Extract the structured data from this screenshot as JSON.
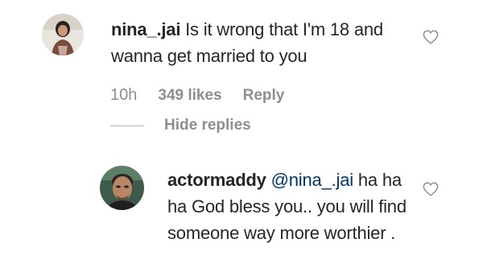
{
  "comments": [
    {
      "username": "nina_.jai",
      "text": " Is it wrong that I'm 18 and wanna get married to you",
      "time": "10h",
      "likes": "349 likes",
      "reply_label": "Reply",
      "hide_replies_label": "Hide replies",
      "avatar_icon": "profile-photo-woman"
    },
    {
      "username": "actormaddy",
      "mention": "@nina_.jai",
      "text": " ha ha ha God bless you.. you will find someone way more worthier .",
      "avatar_icon": "profile-photo-man"
    }
  ],
  "icons": {
    "like": "heart-outline-icon"
  },
  "colors": {
    "text": "#262626",
    "muted": "#8e8e8e",
    "mention": "#003569"
  }
}
